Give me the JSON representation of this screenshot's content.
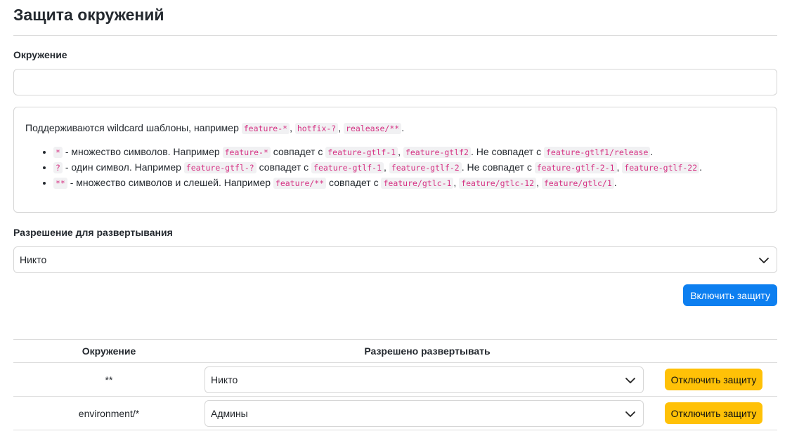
{
  "page": {
    "title": "Защита окружений"
  },
  "form": {
    "env_label": "Окружение",
    "env_value": "",
    "env_placeholder": "",
    "perm_label": "Разрешение для развертывания",
    "perm_value": "Никто",
    "submit_label": "Включить защиту"
  },
  "info": {
    "intro_text": "Поддерживаются wildcard шаблоны, например",
    "intro_examples": [
      "feature-*",
      "hotfix-?",
      "realease/**"
    ],
    "items": [
      {
        "pattern": "*",
        "desc": " - множество символов. Например ",
        "example": "feature-*",
        "matches_label": " совпадет с ",
        "matches": [
          "feature-gtlf-1",
          "feature-gtlf2"
        ],
        "nomatch_label": ". Не совпадет с ",
        "nomatches": [
          "feature-gtlf1/release"
        ]
      },
      {
        "pattern": "?",
        "desc": " - один символ. Например ",
        "example": "feature-gtfl-?",
        "matches_label": " совпадет с ",
        "matches": [
          "feature-gtlf-1",
          "feature-gtlf-2"
        ],
        "nomatch_label": ". Не совпадет с ",
        "nomatches": [
          "feature-gtlf-2-1",
          "feature-gtlf-22"
        ]
      },
      {
        "pattern": "**",
        "desc": " - множество символов и слешей. Например ",
        "example": "feature/**",
        "matches_label": " совпадет с ",
        "matches": [
          "feature/gtlc-1",
          "feature/gtlc-12",
          "feature/gtlc/1"
        ],
        "nomatch_label": "",
        "nomatches": []
      }
    ]
  },
  "table": {
    "headers": [
      "Окружение",
      "Разрешено развертывать",
      ""
    ],
    "rows": [
      {
        "env": "**",
        "permission": "Никто",
        "action": "Отключить защиту"
      },
      {
        "env": "environment/*",
        "permission": "Админы",
        "action": "Отключить защиту"
      }
    ]
  }
}
